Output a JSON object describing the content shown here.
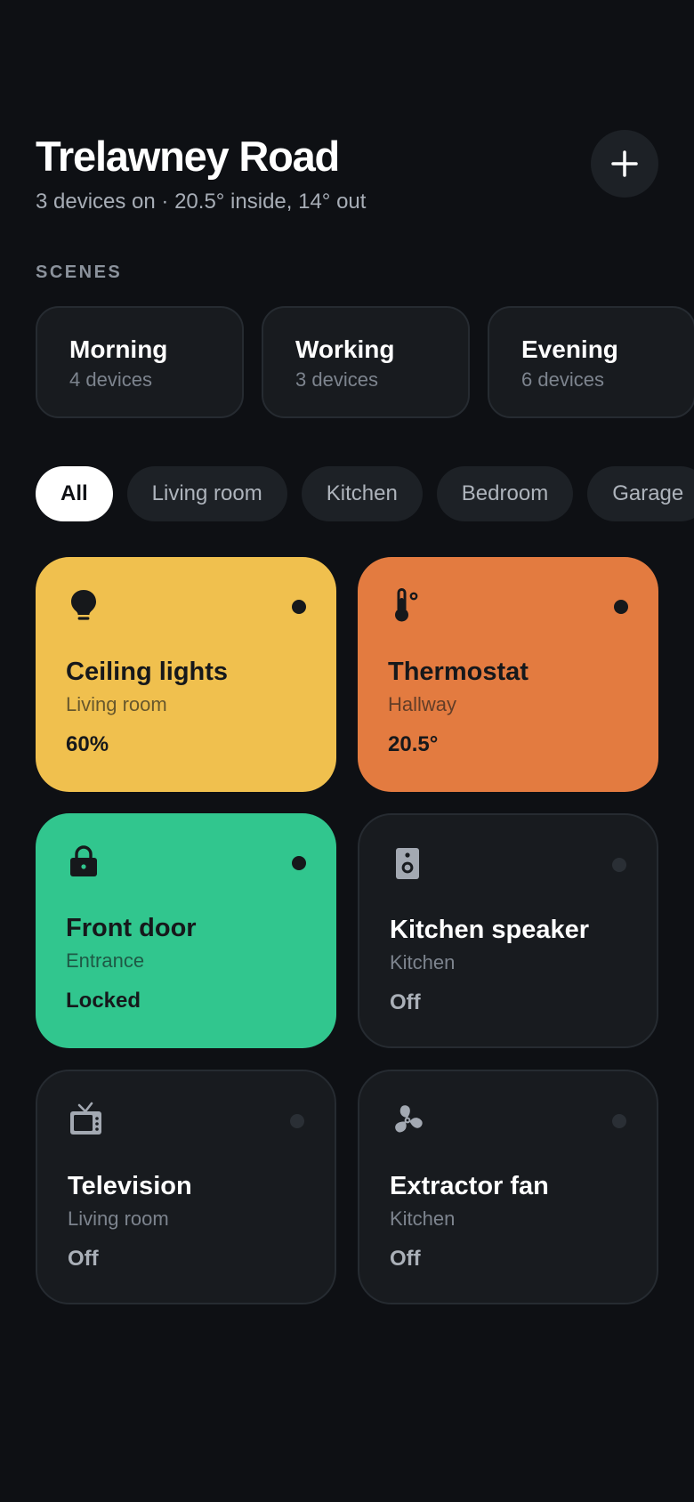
{
  "header": {
    "title": "Trelawney Road",
    "subtitle": "3 devices on · 20.5° inside, 14° out"
  },
  "add_icon": "plus-icon",
  "scenes": {
    "label": "SCENES",
    "items": [
      {
        "name": "Morning",
        "count": "4 devices"
      },
      {
        "name": "Working",
        "count": "3 devices"
      },
      {
        "name": "Evening",
        "count": "6 devices"
      }
    ]
  },
  "filters": {
    "selected": "All",
    "items": [
      "All",
      "Living room",
      "Kitchen",
      "Bedroom",
      "Garage"
    ]
  },
  "devices": [
    {
      "name": "Ceiling lights",
      "room": "Living room",
      "state": "60%",
      "on": true,
      "icon": "lightbulb-icon",
      "color": "#f0c04e"
    },
    {
      "name": "Thermostat",
      "room": "Hallway",
      "state": "20.5°",
      "on": true,
      "icon": "thermometer-icon",
      "color": "#e37b40"
    },
    {
      "name": "Front door",
      "room": "Entrance",
      "state": "Locked",
      "on": true,
      "icon": "lock-icon",
      "color": "#31c68e"
    },
    {
      "name": "Kitchen speaker",
      "room": "Kitchen",
      "state": "Off",
      "on": false,
      "icon": "speaker-icon",
      "color": "#181b1f"
    },
    {
      "name": "Television",
      "room": "Living room",
      "state": "Off",
      "on": false,
      "icon": "tv-icon",
      "color": "#181b1f"
    },
    {
      "name": "Extractor fan",
      "room": "Kitchen",
      "state": "Off",
      "on": false,
      "icon": "fan-icon",
      "color": "#181b1f"
    }
  ],
  "colors": {
    "background": "#0e1014",
    "card_off": "#181b1f",
    "text_on": "#16181b",
    "text_off": "#ffffff",
    "muted_off": "#7d848e"
  }
}
